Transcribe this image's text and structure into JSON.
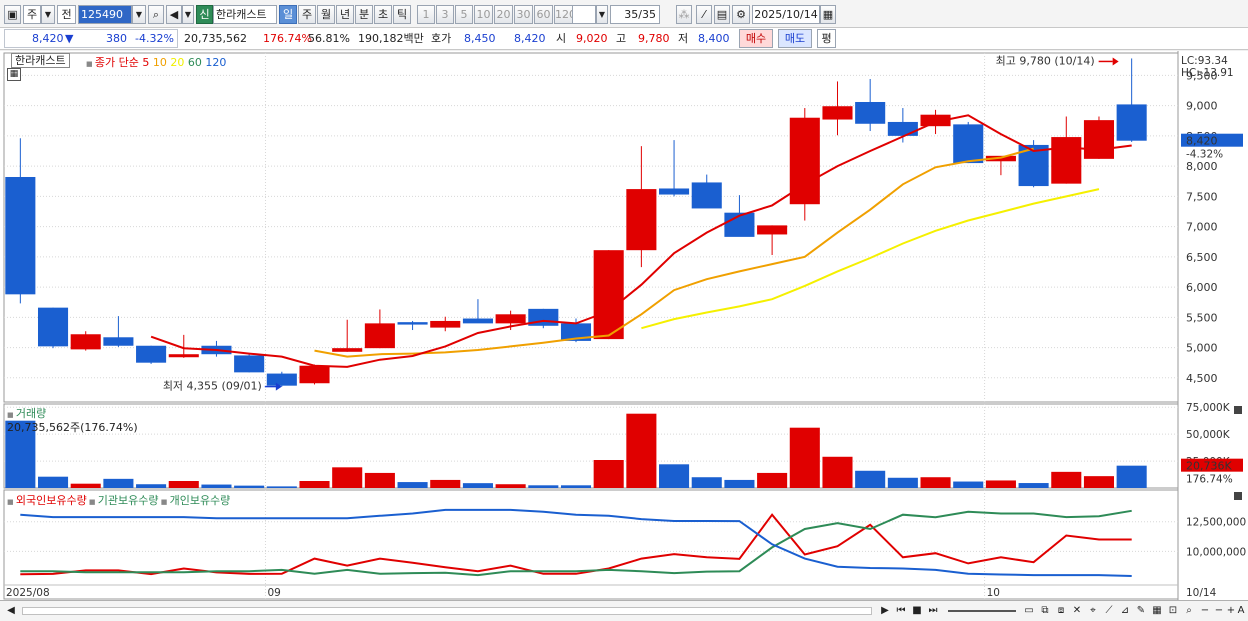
{
  "toolbar": {
    "period_select": "주",
    "prev_label": "전",
    "stock_code": "125490",
    "credit_badge": "신",
    "stock_name": "한라캐스트",
    "periods": [
      "일",
      "주",
      "월",
      "년",
      "분",
      "초",
      "틱"
    ],
    "intervals": [
      "1",
      "3",
      "5",
      "10",
      "20",
      "30",
      "60",
      "120"
    ],
    "count": "35/35",
    "date": "2025/10/14"
  },
  "quote": {
    "price": "8,420",
    "change_arrow": "▼",
    "change": "380",
    "change_pct": "-4.32%",
    "volume": "20,735,562",
    "volume_ratio": "176.74%",
    "turnover": "56.81%",
    "amount": "190,182백만",
    "ask_label": "호가",
    "ask": "8,450",
    "bid": "8,420",
    "open_label": "시",
    "open": "9,020",
    "high_label": "고",
    "high": "9,780",
    "low_label": "저",
    "low": "8,400",
    "buy_label": "매수",
    "sell_label": "매도",
    "eval_label": "평"
  },
  "legend": {
    "stock_name": "한라캐스트",
    "ma_label": "종가 단순",
    "ma_periods": [
      "5",
      "10",
      "20",
      "60",
      "120"
    ],
    "ma_colors": [
      "#e00000",
      "#f0a000",
      "#f0f000",
      "#2e8b57",
      "#1a5fd0"
    ],
    "volume_title": "거래량",
    "volume_info": "20,735,562주(176.74%)",
    "holdings": [
      "외국인보유수량",
      "기관보유수량",
      "개인보유수량"
    ]
  },
  "annotations": {
    "high_text": "최고 9,780 (10/14)",
    "low_text": "최저 4,355 (09/01)",
    "lc_text": "LC:93.34",
    "hc_text": "HC:-13.91",
    "price_tag": "8,420",
    "price_tag_pct": "-4.32%",
    "volume_tag": "20,736K",
    "volume_tag_pct": "176.74%"
  },
  "x_labels": [
    "2025/08",
    "09",
    "10",
    "10/14"
  ],
  "colors": {
    "up": "#e00000",
    "down": "#1a5fd0",
    "accent": "#2f67c6"
  },
  "chart_data": [
    {
      "type": "candlestick",
      "title": "한라캐스트 일봉",
      "y_ticks": [
        4500,
        5000,
        5500,
        6000,
        6500,
        7000,
        7500,
        8000,
        8500,
        9000,
        9500
      ],
      "ylim": [
        4100,
        9870
      ],
      "ohlc": [
        [
          7820,
          8460,
          5730,
          5880
        ],
        [
          5660,
          5660,
          4990,
          5020
        ],
        [
          4970,
          5270,
          4950,
          5220
        ],
        [
          5170,
          5520,
          5010,
          5030
        ],
        [
          5030,
          5030,
          4730,
          4750
        ],
        [
          4840,
          5210,
          4830,
          4890
        ],
        [
          5030,
          5110,
          4850,
          4890
        ],
        [
          4870,
          4910,
          4590,
          4590
        ],
        [
          4570,
          4600,
          4355,
          4370
        ],
        [
          4410,
          4720,
          4390,
          4700
        ],
        [
          4930,
          5460,
          4930,
          4990
        ],
        [
          4990,
          5630,
          4990,
          5400
        ],
        [
          5420,
          5440,
          5290,
          5380
        ],
        [
          5330,
          5510,
          5270,
          5440
        ],
        [
          5480,
          5800,
          5420,
          5400
        ],
        [
          5400,
          5610,
          5290,
          5550
        ],
        [
          5640,
          5640,
          5320,
          5360
        ],
        [
          5400,
          5480,
          5090,
          5110
        ],
        [
          5140,
          6610,
          5140,
          6610
        ],
        [
          6610,
          8330,
          6330,
          7620
        ],
        [
          7630,
          8430,
          7500,
          7530
        ],
        [
          7730,
          7860,
          7320,
          7300
        ],
        [
          7230,
          7520,
          6850,
          6830
        ],
        [
          6870,
          7020,
          6530,
          7020
        ],
        [
          7370,
          8960,
          7100,
          8800
        ],
        [
          8770,
          9400,
          8510,
          8990
        ],
        [
          9060,
          9440,
          8580,
          8700
        ],
        [
          8730,
          8960,
          8390,
          8500
        ],
        [
          8660,
          8930,
          8530,
          8850
        ],
        [
          8690,
          8730,
          8050,
          8050
        ],
        [
          8080,
          8120,
          7850,
          8170
        ],
        [
          8350,
          8430,
          7650,
          7670
        ],
        [
          7710,
          8820,
          7710,
          8480
        ],
        [
          8120,
          8820,
          8120,
          8760
        ],
        [
          9020,
          9780,
          8400,
          8420
        ]
      ],
      "ma5": [
        null,
        null,
        null,
        null,
        5180,
        4990,
        4960,
        4900,
        4850,
        4700,
        4680,
        4800,
        4860,
        5020,
        5240,
        5350,
        5440,
        5400,
        5600,
        6040,
        6560,
        6900,
        7180,
        7350,
        7700,
        8000,
        8250,
        8490,
        8730,
        8840,
        8530,
        8250,
        8310,
        8270,
        8340
      ],
      "ma10": [
        null,
        null,
        null,
        null,
        null,
        null,
        null,
        null,
        null,
        4950,
        4850,
        4890,
        4900,
        4920,
        4960,
        5020,
        5080,
        5150,
        5200,
        5550,
        5950,
        6130,
        6260,
        6380,
        6500,
        6900,
        7280,
        7700,
        7980,
        8080,
        8140,
        8290
      ],
      "ma20": [
        null,
        null,
        null,
        null,
        null,
        null,
        null,
        null,
        null,
        null,
        null,
        null,
        null,
        null,
        null,
        null,
        null,
        null,
        null,
        5320,
        5470,
        5580,
        5680,
        5800,
        6020,
        6260,
        6480,
        6720,
        6930,
        7100,
        7240,
        7380,
        7500,
        7620
      ],
      "volume_unit": "주",
      "volume_ticks": [
        "75,000K",
        "50,000K",
        "25,000K"
      ],
      "volume_k": [
        62500,
        10500,
        4000,
        8500,
        3500,
        6500,
        3200,
        2200,
        1500,
        6500,
        19200,
        14000,
        5500,
        7500,
        4500,
        3500,
        2500,
        2500,
        26000,
        69000,
        22000,
        10000,
        7500,
        14000,
        56000,
        29000,
        16000,
        9500,
        10000,
        6000,
        7000,
        4600,
        15000,
        11000,
        20736
      ],
      "holdings_ticks": [
        "12,500,000",
        "10,000,000"
      ],
      "holdings_series": [
        {
          "name": "외국인보유수량",
          "color": "#e00000",
          "values": [
            8080,
            8100,
            8400,
            8400,
            8090,
            8560,
            8230,
            8100,
            8110,
            9390,
            8800,
            9390,
            9040,
            8660,
            8330,
            8800,
            8110,
            8110,
            8560,
            9390,
            9770,
            9500,
            9370,
            13090,
            9740,
            10440,
            12240,
            9500,
            9850,
            8990,
            9500,
            9090,
            11340,
            11000,
            11000
          ]
        },
        {
          "name": "기관보유수량",
          "color": "#2e8b57",
          "values": [
            8330,
            8330,
            8250,
            8250,
            8250,
            8250,
            8330,
            8330,
            8440,
            8110,
            8440,
            8110,
            8170,
            8200,
            8000,
            8330,
            8330,
            8330,
            8440,
            8330,
            8170,
            8300,
            8330,
            10340,
            11890,
            12380,
            11890,
            13090,
            12880,
            13340,
            13190,
            13190,
            12890,
            12970,
            13420
          ]
        },
        {
          "name": "개인보유수량",
          "color": "#1a5fd0",
          "values": [
            13090,
            12890,
            12890,
            12890,
            12890,
            12890,
            12800,
            12800,
            12800,
            12800,
            12800,
            13000,
            13190,
            13500,
            13500,
            13500,
            13340,
            13090,
            13000,
            12720,
            12560,
            12560,
            12550,
            10600,
            9390,
            8710,
            8600,
            8560,
            8440,
            8110,
            8050,
            8000,
            8000,
            8000,
            7930
          ]
        }
      ]
    }
  ]
}
